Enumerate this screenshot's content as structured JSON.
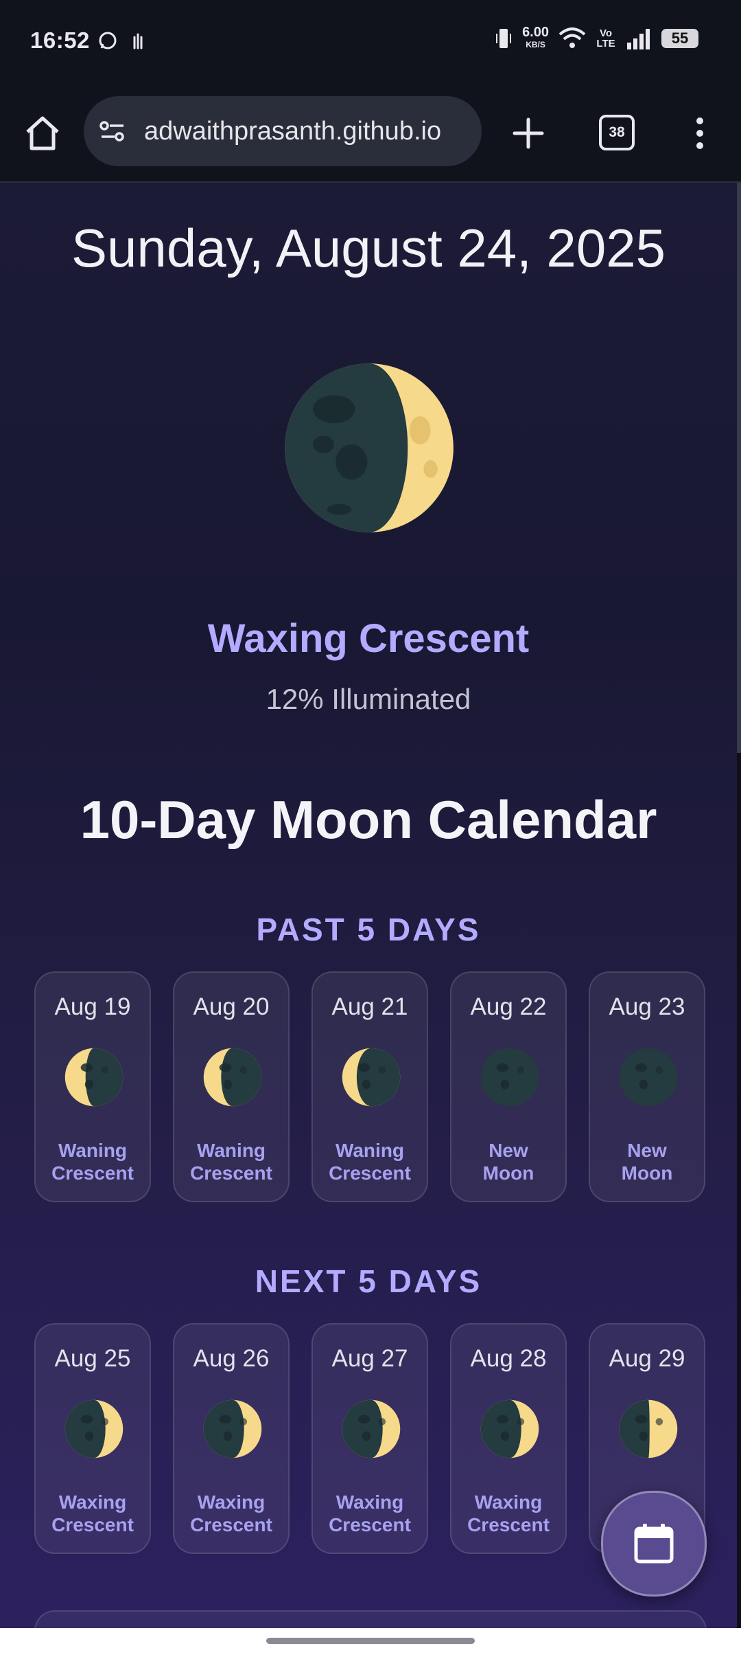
{
  "status_bar": {
    "time": "16:52",
    "net_speed": "6.00",
    "net_unit": "KB/S",
    "volte": "Vo LTE",
    "battery": "55"
  },
  "browser": {
    "url": "adwaithprasanth.github.io",
    "tab_count": "38"
  },
  "today": {
    "date": "Sunday, August 24, 2025",
    "phase": "Waxing Crescent",
    "illumination": "12% Illuminated"
  },
  "calendar": {
    "title": "10-Day Moon Calendar",
    "past_title": "PAST 5 DAYS",
    "next_title": "NEXT 5 DAYS",
    "past": [
      {
        "date": "Aug 19",
        "phase_line1": "Waning",
        "phase_line2": "Crescent",
        "lit": "left",
        "fraction": 0.35
      },
      {
        "date": "Aug 20",
        "phase_line1": "Waning",
        "phase_line2": "Crescent",
        "lit": "left",
        "fraction": 0.3
      },
      {
        "date": "Aug 21",
        "phase_line1": "Waning",
        "phase_line2": "Crescent",
        "lit": "left",
        "fraction": 0.25
      },
      {
        "date": "Aug 22",
        "phase_line1": "New",
        "phase_line2": "Moon",
        "lit": "none",
        "fraction": 0
      },
      {
        "date": "Aug 23",
        "phase_line1": "New",
        "phase_line2": "Moon",
        "lit": "none",
        "fraction": 0
      }
    ],
    "next": [
      {
        "date": "Aug 25",
        "phase_line1": "Waxing",
        "phase_line2": "Crescent",
        "lit": "right",
        "fraction": 0.3
      },
      {
        "date": "Aug 26",
        "phase_line1": "Waxing",
        "phase_line2": "Crescent",
        "lit": "right",
        "fraction": 0.3
      },
      {
        "date": "Aug 27",
        "phase_line1": "Waxing",
        "phase_line2": "Crescent",
        "lit": "right",
        "fraction": 0.3
      },
      {
        "date": "Aug 28",
        "phase_line1": "Waxing",
        "phase_line2": "Crescent",
        "lit": "right",
        "fraction": 0.3
      },
      {
        "date": "Aug 29",
        "phase_line1": "",
        "phase_line2": "",
        "lit": "right",
        "fraction": 0.5
      }
    ]
  },
  "colors": {
    "accent": "#b3abff",
    "moon_dark": "#243b3f",
    "moon_light": "#f6d98a"
  }
}
